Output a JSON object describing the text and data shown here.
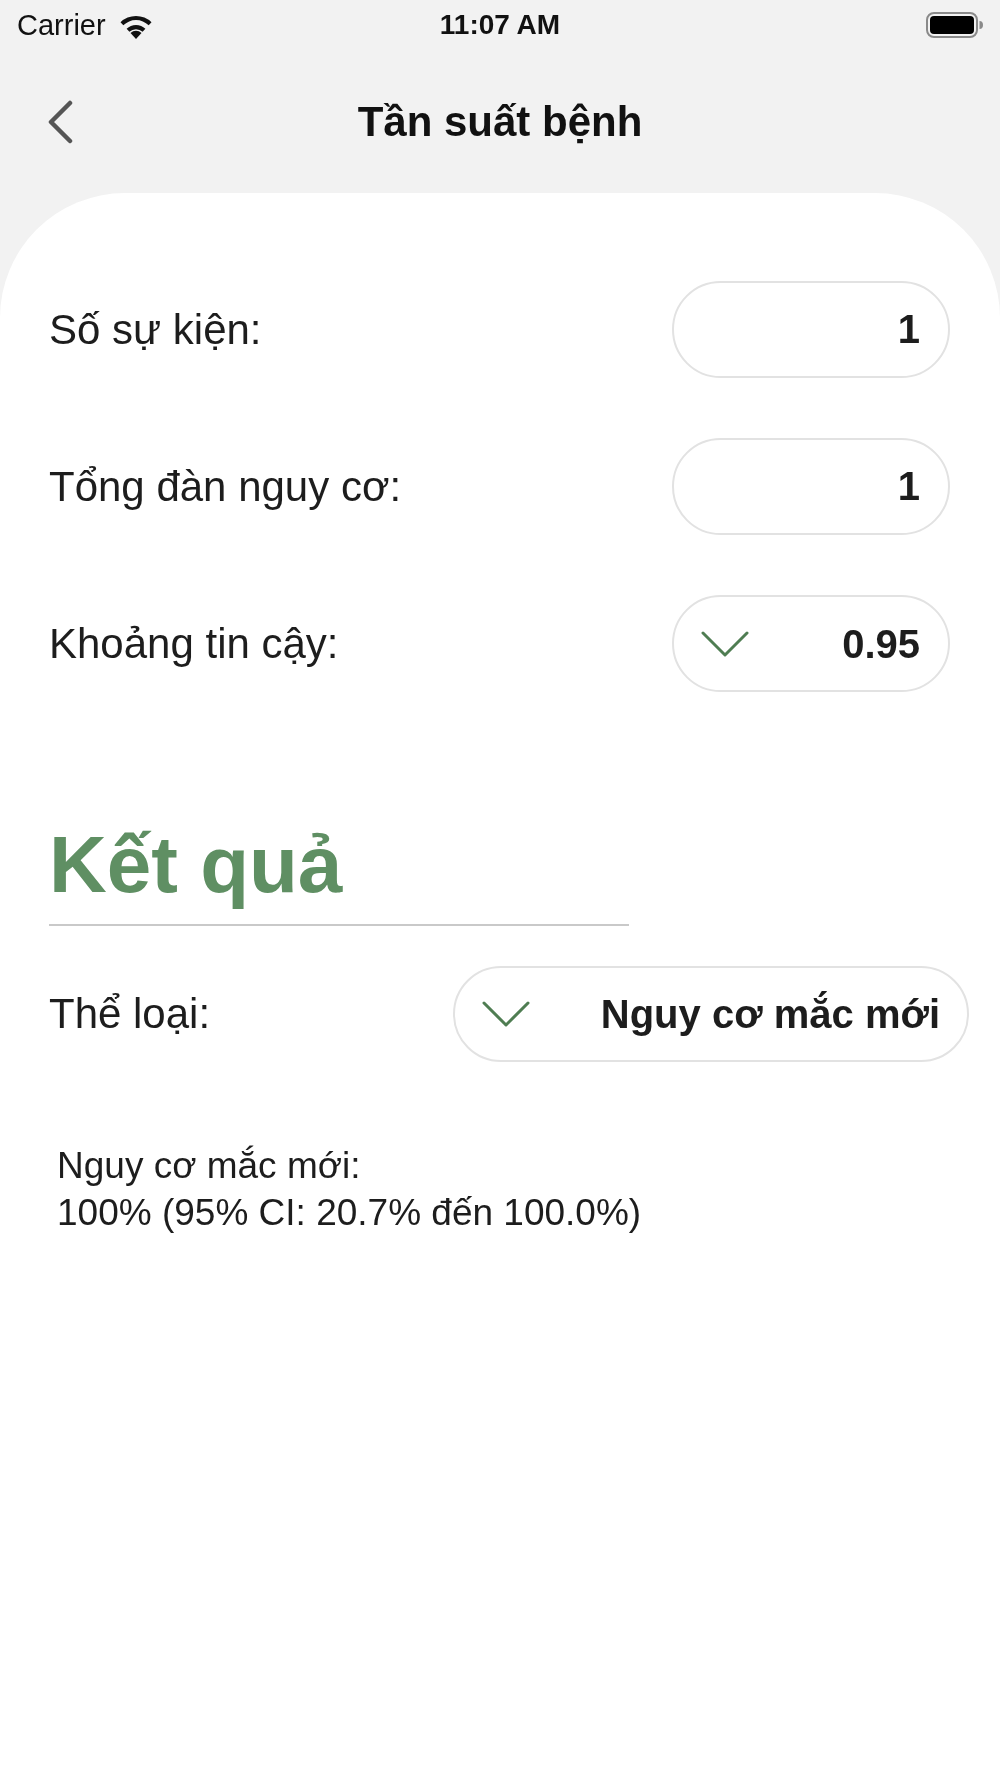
{
  "status_bar": {
    "carrier": "Carrier",
    "time": "11:07 AM"
  },
  "nav_bar": {
    "title": "Tần suất bệnh"
  },
  "inputs": [
    {
      "kind": "number",
      "label": "Số sự kiện:",
      "value": "1"
    },
    {
      "kind": "number",
      "label": "Tổng đàn nguy cơ:",
      "value": "1"
    },
    {
      "kind": "dropdown",
      "label": "Khoảng tin cậy:",
      "value": "0.95"
    }
  ],
  "results": {
    "heading": "Kết quả",
    "category": {
      "label": "Thể loại:",
      "value": "Nguy cơ mắc mới"
    },
    "output": {
      "label": "Nguy cơ mắc mới:",
      "value": "100% (95% CI: 20.7% đến 100.0%)"
    }
  }
}
